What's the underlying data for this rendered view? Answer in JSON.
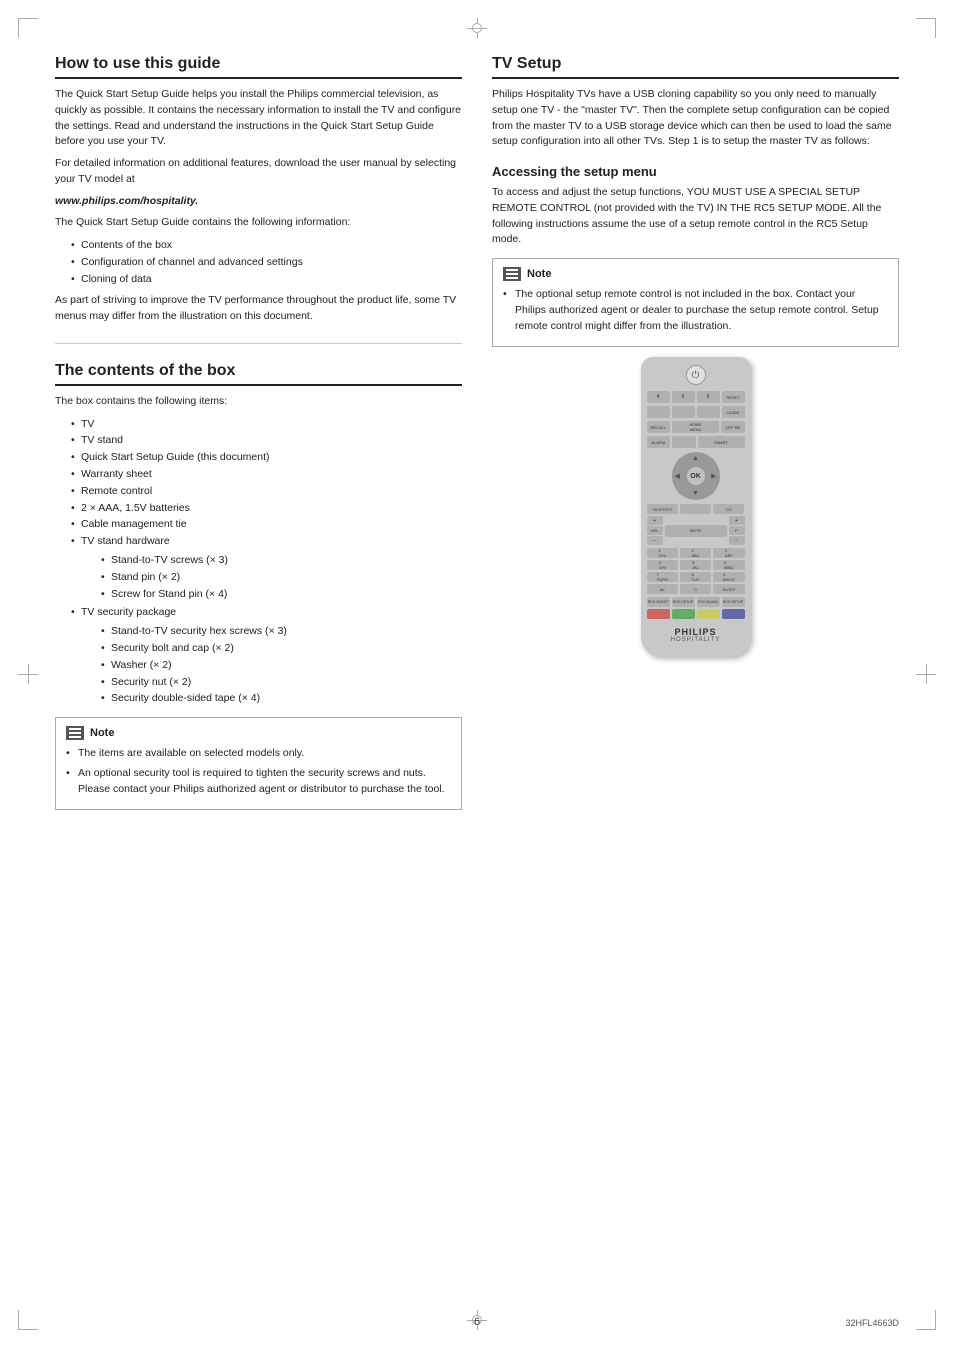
{
  "page": {
    "number": "6",
    "model": "32HFL4663D"
  },
  "left_column": {
    "section1": {
      "heading": "How to use this guide",
      "para1": "The Quick Start Setup Guide helps you install the Philips commercial television, as quickly as possible. It contains the necessary information to install the TV and configure the settings. Read and understand the instructions in the Quick Start Setup Guide before you use your TV.",
      "para2": "For detailed information on additional features, download the user manual by selecting your TV model at",
      "website": "www.philips.com/hospitality.",
      "para3": "The Quick Start Setup Guide contains the following information:",
      "items": [
        "Contents of the box",
        "Configuration of channel and advanced settings",
        "Cloning of data"
      ],
      "para4": "As part of striving to improve the TV performance throughout the product life, some TV menus may differ from the illustration on this document."
    },
    "section2": {
      "heading": "The contents of the box",
      "intro": "The box contains the following items:",
      "items": [
        "TV",
        "TV stand",
        "Quick Start Setup Guide (this document)",
        "Warranty sheet",
        "Remote control",
        "2 × AAA, 1.5V batteries",
        "Cable management tie",
        "TV stand hardware"
      ],
      "stand_hardware_subitems": [
        "Stand-to-TV screws (× 3)",
        "Stand pin (× 2)",
        "Screw for Stand pin (× 4)"
      ],
      "security_package_label": "TV security package",
      "security_subitems": [
        "Stand-to-TV security hex screws (× 3)",
        "Security bolt and cap (× 2)",
        "Washer (× 2)",
        "Security nut (× 2)",
        "Security double-sided tape (× 4)"
      ],
      "note": {
        "label": "Note",
        "bullets": [
          "The items are available on selected models only.",
          "An optional security tool is required to tighten the security screws and nuts. Please contact your Philips authorized agent or distributor to purchase the tool."
        ]
      }
    }
  },
  "right_column": {
    "section1": {
      "heading": "TV Setup",
      "para1": "Philips Hospitality TVs have a USB cloning capability so you only need to manually setup one TV - the \"master TV\". Then the complete setup configuration can be copied from the master TV to a USB storage device which can then be used to load the same setup configuration into all other TVs. Step 1 is to setup the master TV as follows:"
    },
    "section2": {
      "heading": "Accessing the setup menu",
      "para1": "To access and adjust the setup functions, YOU MUST USE A SPECIAL SETUP REMOTE CONTROL (not provided with the TV) IN THE RC5 SETUP MODE. All the following instructions assume the use of a setup remote control in the RC5 Setup mode.",
      "note": {
        "label": "Note",
        "bullets": [
          "The optional setup remote control is not included in the box. Contact your Philips authorized agent or dealer to purchase the setup remote control. Setup remote control might differ from the illustration."
        ]
      }
    },
    "remote": {
      "brand": "PHILIPS",
      "subbrand": "HOSPITALITY"
    }
  }
}
